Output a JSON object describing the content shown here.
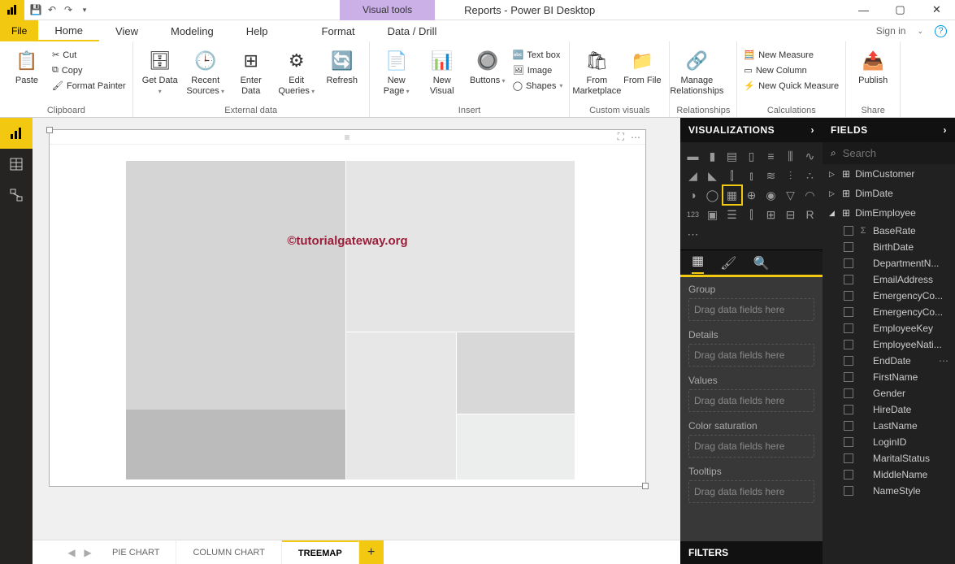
{
  "title": "Reports - Power BI Desktop",
  "context_tab": "Visual tools",
  "menu": {
    "file": "File",
    "tabs": [
      "Home",
      "View",
      "Modeling",
      "Help"
    ],
    "ctx": [
      "Format",
      "Data / Drill"
    ],
    "signin": "Sign in"
  },
  "ribbon": {
    "clipboard": {
      "label": "Clipboard",
      "paste": "Paste",
      "cut": "Cut",
      "copy": "Copy",
      "fmt": "Format Painter"
    },
    "external": {
      "label": "External data",
      "get": "Get\nData",
      "recent": "Recent\nSources",
      "enter": "Enter\nData",
      "edit": "Edit\nQueries",
      "refresh": "Refresh"
    },
    "insert": {
      "label": "Insert",
      "newpage": "New\nPage",
      "newvis": "New\nVisual",
      "buttons": "Buttons",
      "textbox": "Text box",
      "image": "Image",
      "shapes": "Shapes"
    },
    "custom": {
      "label": "Custom visuals",
      "market": "From\nMarketplace",
      "file": "From\nFile"
    },
    "rel": {
      "label": "Relationships",
      "manage": "Manage\nRelationships"
    },
    "calc": {
      "label": "Calculations",
      "nm": "New Measure",
      "nc": "New Column",
      "nqm": "New Quick Measure"
    },
    "share": {
      "label": "Share",
      "publish": "Publish"
    }
  },
  "watermark": "©tutorialgateway.org",
  "page_tabs": [
    "PIE CHART",
    "COLUMN CHART",
    "TREEMAP"
  ],
  "viz_panel": {
    "title": "VISUALIZATIONS",
    "wells": [
      {
        "label": "Group",
        "dz": "Drag data fields here"
      },
      {
        "label": "Details",
        "dz": "Drag data fields here"
      },
      {
        "label": "Values",
        "dz": "Drag data fields here"
      },
      {
        "label": "Color saturation",
        "dz": "Drag data fields here"
      },
      {
        "label": "Tooltips",
        "dz": "Drag data fields here"
      }
    ],
    "filters": "FILTERS"
  },
  "fields_panel": {
    "title": "FIELDS",
    "search": "Search",
    "tables": [
      {
        "name": "DimCustomer",
        "expanded": false
      },
      {
        "name": "DimDate",
        "expanded": false
      },
      {
        "name": "DimEmployee",
        "expanded": true,
        "fields": [
          {
            "name": "BaseRate",
            "sigma": true
          },
          {
            "name": "BirthDate"
          },
          {
            "name": "DepartmentN..."
          },
          {
            "name": "EmailAddress"
          },
          {
            "name": "EmergencyCo..."
          },
          {
            "name": "EmergencyCo..."
          },
          {
            "name": "EmployeeKey"
          },
          {
            "name": "EmployeeNati..."
          },
          {
            "name": "EndDate",
            "more": true
          },
          {
            "name": "FirstName"
          },
          {
            "name": "Gender"
          },
          {
            "name": "HireDate"
          },
          {
            "name": "LastName"
          },
          {
            "name": "LoginID"
          },
          {
            "name": "MaritalStatus"
          },
          {
            "name": "MiddleName"
          },
          {
            "name": "NameStyle"
          }
        ]
      }
    ]
  }
}
